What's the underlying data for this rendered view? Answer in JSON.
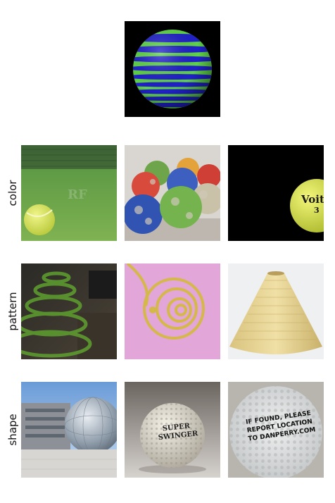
{
  "rows": [
    {
      "label": "color"
    },
    {
      "label": "pattern"
    },
    {
      "label": "shape"
    }
  ],
  "images": {
    "query": {
      "icon": "striped-sphere"
    },
    "color": [
      {
        "icon": "tennis-ball-on-grass",
        "text": "RF"
      },
      {
        "icon": "painted-balls"
      },
      {
        "icon": "tennis-ball-dark",
        "text1": "Voit",
        "text2": "3"
      }
    ],
    "pattern": [
      {
        "icon": "green-spiral"
      },
      {
        "icon": "yellow-wire-spiral"
      },
      {
        "icon": "ribbed-cone"
      }
    ],
    "shape": [
      {
        "icon": "mirror-dome-building"
      },
      {
        "icon": "golf-ball",
        "text1": "SUPER",
        "text2": "SWINGER"
      },
      {
        "icon": "golf-ball-closeup",
        "lines": [
          "IF FOUND, PLEASE",
          "REPORT LOCATION",
          "TO DANPERRY.COM"
        ]
      }
    ]
  },
  "colors": {
    "stripe_green": "#5fd14a",
    "stripe_blue": "#2020c8",
    "tennis_yellow": "#d7e34a"
  }
}
